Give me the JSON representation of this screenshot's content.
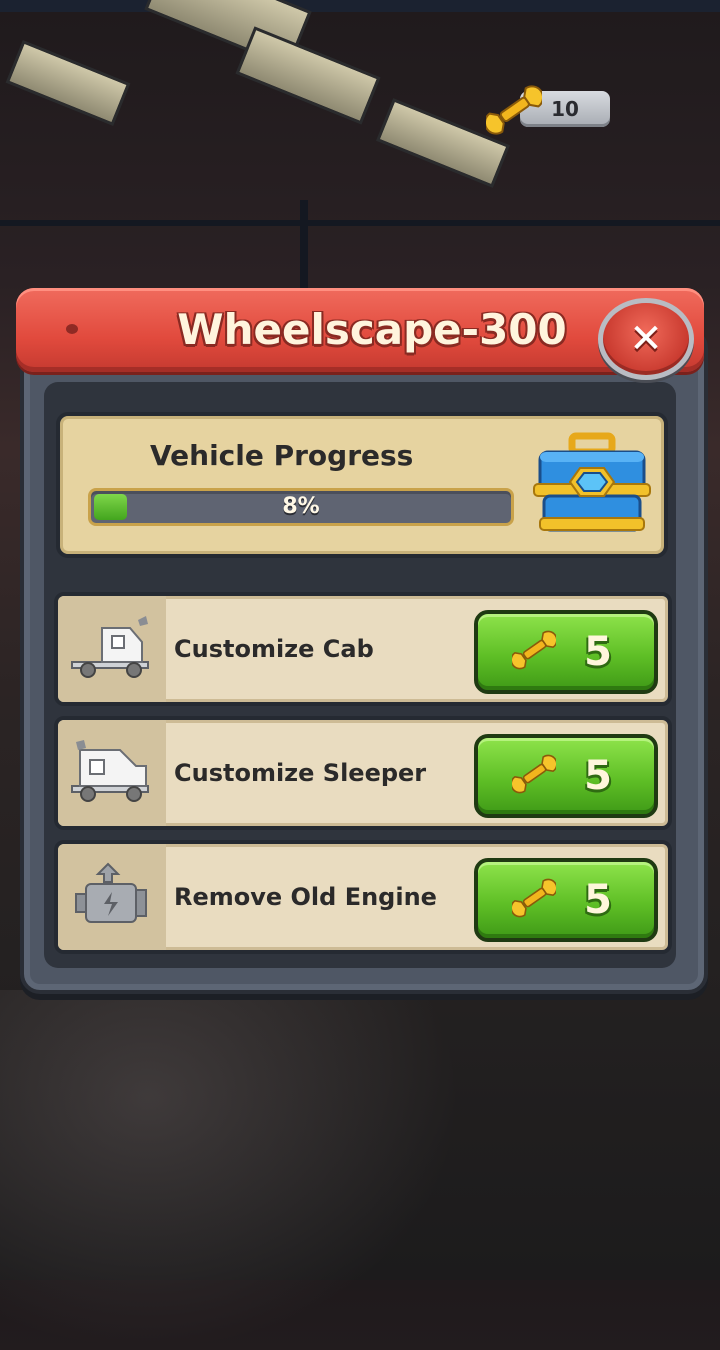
{
  "currency": {
    "icon": "wrench-icon",
    "value": "10"
  },
  "panel": {
    "title": "Wheelscape-300",
    "close_icon": "close-icon",
    "close_label": "✕",
    "header_color": "#e14a3d"
  },
  "progress": {
    "label": "Vehicle Progress",
    "percent_text": "8%",
    "fraction": 0.08,
    "reward_icon": "toolbox-icon",
    "fill_color": "#5fbf26"
  },
  "tasks": [
    {
      "label": "Customize Cab",
      "icon": "truck-cab-icon",
      "cost_icon": "wrench-icon",
      "cost": "5"
    },
    {
      "label": "Customize Sleeper",
      "icon": "truck-sleeper-icon",
      "cost_icon": "wrench-icon",
      "cost": "5"
    },
    {
      "label": "Remove Old Engine",
      "icon": "engine-icon",
      "cost_icon": "wrench-icon",
      "cost": "5"
    }
  ],
  "colors": {
    "button_green": "#5fbf26",
    "card_beige": "#e9dcc0",
    "panel_slate": "#4f5765"
  }
}
